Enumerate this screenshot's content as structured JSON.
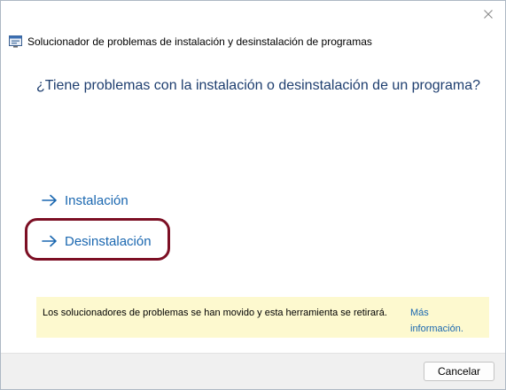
{
  "window": {
    "title": "Solucionador de problemas de instalación y desinstalación de programas"
  },
  "icons": {
    "close": "close-icon",
    "app": "troubleshooter-app-icon",
    "arrow": "arrow-right-icon"
  },
  "main": {
    "question": "¿Tiene problemas con la instalación o desinstalación de un programa?",
    "options": [
      {
        "label": "Instalación"
      },
      {
        "label": "Desinstalación",
        "highlighted": true
      }
    ]
  },
  "notice": {
    "text": "Los solucionadores de problemas se han movido y esta herramienta se retirará.",
    "link_line1": "Más",
    "link_line2": "información."
  },
  "footer": {
    "cancel_label": "Cancelar"
  },
  "colors": {
    "link": "#1a67b0",
    "heading": "#1e3e6f",
    "highlight_ring": "#7c0f24",
    "notice_bg": "#fdf9cf",
    "footer_bg": "#f0f0f0"
  }
}
